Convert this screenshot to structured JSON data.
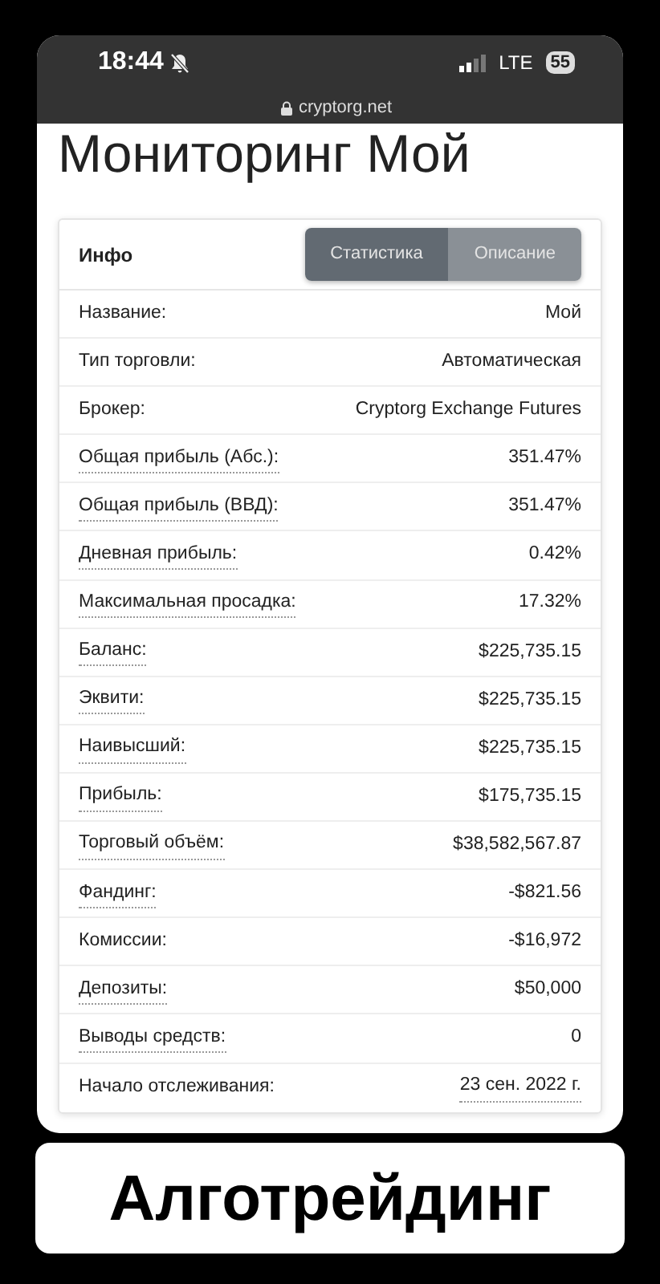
{
  "status_bar": {
    "time": "18:44",
    "network": "LTE",
    "battery": "55"
  },
  "address_bar": {
    "url": "cryptorg.net"
  },
  "page_title": "Мониторинг Мой",
  "info_card": {
    "heading": "Инфо",
    "tabs": [
      {
        "label": "Статистика",
        "selected": true
      },
      {
        "label": "Описание",
        "selected": false
      }
    ],
    "rows": [
      {
        "label": "Название:",
        "value": "Мой",
        "tooltip": false,
        "value_tooltip": false
      },
      {
        "label": "Тип торговли:",
        "value": "Автоматическая",
        "tooltip": false,
        "value_tooltip": false
      },
      {
        "label": "Брокер:",
        "value": "Cryptorg Exchange Futures",
        "tooltip": false,
        "value_tooltip": false
      },
      {
        "label": "Общая прибыль (Абс.):",
        "value": "351.47%",
        "tooltip": true,
        "value_tooltip": false
      },
      {
        "label": "Общая прибыль (ВВД):",
        "value": "351.47%",
        "tooltip": true,
        "value_tooltip": false
      },
      {
        "label": "Дневная прибыль:",
        "value": "0.42%",
        "tooltip": true,
        "value_tooltip": false
      },
      {
        "label": "Максимальная просадка:",
        "value": "17.32%",
        "tooltip": true,
        "value_tooltip": false
      },
      {
        "label": "Баланс:",
        "value": "$225,735.15",
        "tooltip": true,
        "value_tooltip": false
      },
      {
        "label": "Эквити:",
        "value": "$225,735.15",
        "tooltip": true,
        "value_tooltip": false
      },
      {
        "label": "Наивысший:",
        "value": "$225,735.15",
        "tooltip": true,
        "value_tooltip": false
      },
      {
        "label": "Прибыль:",
        "value": "$175,735.15",
        "tooltip": true,
        "value_tooltip": false
      },
      {
        "label": "Торговый объём:",
        "value": "$38,582,567.87",
        "tooltip": true,
        "value_tooltip": false
      },
      {
        "label": "Фандинг:",
        "value": "-$821.56",
        "tooltip": true,
        "value_tooltip": false
      },
      {
        "label": "Комиссии:",
        "value": "-$16,972",
        "tooltip": false,
        "value_tooltip": false
      },
      {
        "label": "Депозиты:",
        "value": "$50,000",
        "tooltip": true,
        "value_tooltip": false
      },
      {
        "label": "Выводы средств:",
        "value": "0",
        "tooltip": true,
        "value_tooltip": false
      },
      {
        "label": "Начало отслеживания:",
        "value": "23 сен. 2022 г.",
        "tooltip": false,
        "value_tooltip": true
      }
    ]
  },
  "caption": "Алготрейдинг"
}
